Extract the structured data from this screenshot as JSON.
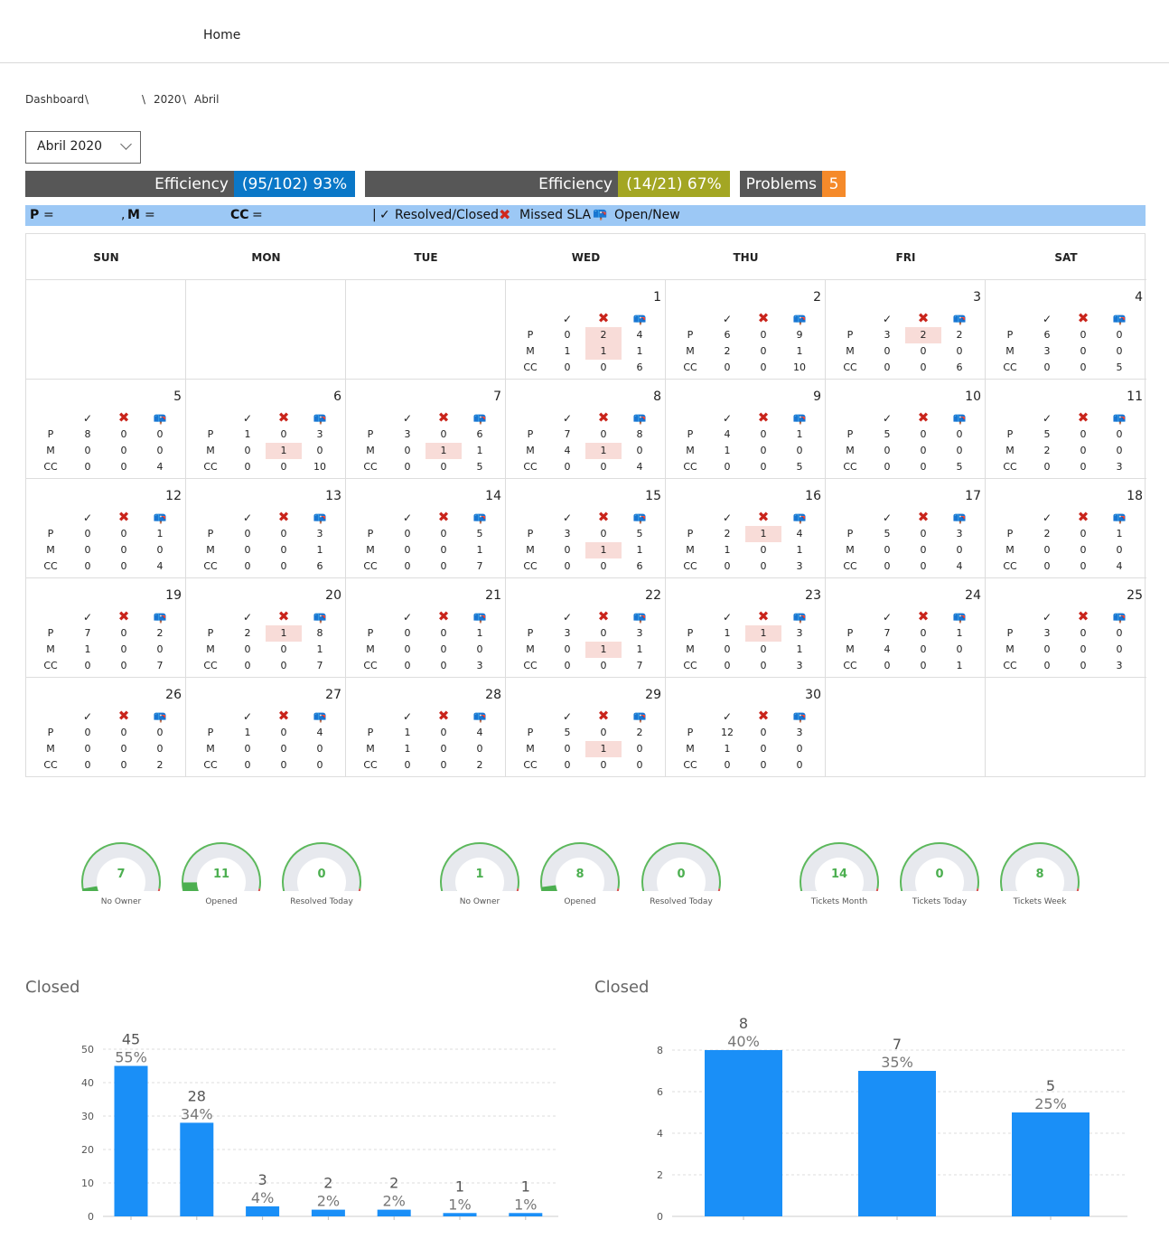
{
  "nav": {
    "home": "Home"
  },
  "breadcrumb": {
    "dashboard": "Dashboard",
    "sep": "\\",
    "year": "2020",
    "month": "Abril"
  },
  "month_select": {
    "value": "Abril 2020"
  },
  "efficiency1": {
    "label": "Efficiency",
    "value": "(95/102) 93%",
    "color": "#0a77c7"
  },
  "efficiency2": {
    "label": "Efficiency",
    "value": "(14/21) 67%",
    "color": "#a3a623"
  },
  "problems": {
    "label": "Problems",
    "value": "5",
    "color": "#f58a2a"
  },
  "legend": {
    "p": "P",
    "m": "M",
    "cc": "CC",
    "eq": "=",
    "sep": "|",
    "resolved": "Resolved/Closed",
    "missed": "Missed SLA",
    "open": "Open/New",
    "resolved_icon": "check-icon",
    "missed_icon": "x-mark-icon",
    "open_icon": "mailbox-icon"
  },
  "calendar": {
    "weekdays": [
      "SUN",
      "MON",
      "TUE",
      "WED",
      "THU",
      "FRI",
      "SAT"
    ],
    "row_labels": [
      "P",
      "M",
      "CC"
    ],
    "icons": {
      "check": "✓",
      "x": "✖",
      "open": "📪"
    },
    "first_weekday": 3,
    "days": [
      {
        "n": "1",
        "r": [
          [
            "0",
            "2",
            "4"
          ],
          [
            "1",
            "1",
            "1"
          ],
          [
            "0",
            "0",
            "6"
          ]
        ],
        "hl": [
          [
            0,
            1
          ],
          [
            1,
            1
          ]
        ]
      },
      {
        "n": "2",
        "r": [
          [
            "6",
            "0",
            "9"
          ],
          [
            "2",
            "0",
            "1"
          ],
          [
            "0",
            "0",
            "10"
          ]
        ],
        "hl": []
      },
      {
        "n": "3",
        "r": [
          [
            "3",
            "2",
            "2"
          ],
          [
            "0",
            "0",
            "0"
          ],
          [
            "0",
            "0",
            "6"
          ]
        ],
        "hl": [
          [
            0,
            1
          ]
        ]
      },
      {
        "n": "4",
        "r": [
          [
            "6",
            "0",
            "0"
          ],
          [
            "3",
            "0",
            "0"
          ],
          [
            "0",
            "0",
            "5"
          ]
        ],
        "hl": []
      },
      {
        "n": "5",
        "r": [
          [
            "8",
            "0",
            "0"
          ],
          [
            "0",
            "0",
            "0"
          ],
          [
            "0",
            "0",
            "4"
          ]
        ],
        "hl": []
      },
      {
        "n": "6",
        "r": [
          [
            "1",
            "0",
            "3"
          ],
          [
            "0",
            "1",
            "0"
          ],
          [
            "0",
            "0",
            "10"
          ]
        ],
        "hl": [
          [
            1,
            1
          ]
        ]
      },
      {
        "n": "7",
        "r": [
          [
            "3",
            "0",
            "6"
          ],
          [
            "0",
            "1",
            "1"
          ],
          [
            "0",
            "0",
            "5"
          ]
        ],
        "hl": [
          [
            1,
            1
          ]
        ]
      },
      {
        "n": "8",
        "r": [
          [
            "7",
            "0",
            "8"
          ],
          [
            "4",
            "1",
            "0"
          ],
          [
            "0",
            "0",
            "4"
          ]
        ],
        "hl": [
          [
            1,
            1
          ]
        ]
      },
      {
        "n": "9",
        "r": [
          [
            "4",
            "0",
            "1"
          ],
          [
            "1",
            "0",
            "0"
          ],
          [
            "0",
            "0",
            "5"
          ]
        ],
        "hl": []
      },
      {
        "n": "10",
        "r": [
          [
            "5",
            "0",
            "0"
          ],
          [
            "0",
            "0",
            "0"
          ],
          [
            "0",
            "0",
            "5"
          ]
        ],
        "hl": []
      },
      {
        "n": "11",
        "r": [
          [
            "5",
            "0",
            "0"
          ],
          [
            "2",
            "0",
            "0"
          ],
          [
            "0",
            "0",
            "3"
          ]
        ],
        "hl": []
      },
      {
        "n": "12",
        "r": [
          [
            "0",
            "0",
            "1"
          ],
          [
            "0",
            "0",
            "0"
          ],
          [
            "0",
            "0",
            "4"
          ]
        ],
        "hl": []
      },
      {
        "n": "13",
        "r": [
          [
            "0",
            "0",
            "3"
          ],
          [
            "0",
            "0",
            "1"
          ],
          [
            "0",
            "0",
            "6"
          ]
        ],
        "hl": []
      },
      {
        "n": "14",
        "r": [
          [
            "0",
            "0",
            "5"
          ],
          [
            "0",
            "0",
            "1"
          ],
          [
            "0",
            "0",
            "7"
          ]
        ],
        "hl": []
      },
      {
        "n": "15",
        "r": [
          [
            "3",
            "0",
            "5"
          ],
          [
            "0",
            "1",
            "1"
          ],
          [
            "0",
            "0",
            "6"
          ]
        ],
        "hl": [
          [
            1,
            1
          ]
        ]
      },
      {
        "n": "16",
        "r": [
          [
            "2",
            "1",
            "4"
          ],
          [
            "1",
            "0",
            "1"
          ],
          [
            "0",
            "0",
            "3"
          ]
        ],
        "hl": [
          [
            0,
            1
          ]
        ]
      },
      {
        "n": "17",
        "r": [
          [
            "5",
            "0",
            "3"
          ],
          [
            "0",
            "0",
            "0"
          ],
          [
            "0",
            "0",
            "4"
          ]
        ],
        "hl": []
      },
      {
        "n": "18",
        "r": [
          [
            "2",
            "0",
            "1"
          ],
          [
            "0",
            "0",
            "0"
          ],
          [
            "0",
            "0",
            "4"
          ]
        ],
        "hl": []
      },
      {
        "n": "19",
        "r": [
          [
            "7",
            "0",
            "2"
          ],
          [
            "1",
            "0",
            "0"
          ],
          [
            "0",
            "0",
            "7"
          ]
        ],
        "hl": []
      },
      {
        "n": "20",
        "r": [
          [
            "2",
            "1",
            "8"
          ],
          [
            "0",
            "0",
            "1"
          ],
          [
            "0",
            "0",
            "7"
          ]
        ],
        "hl": [
          [
            0,
            1
          ]
        ]
      },
      {
        "n": "21",
        "r": [
          [
            "0",
            "0",
            "1"
          ],
          [
            "0",
            "0",
            "0"
          ],
          [
            "0",
            "0",
            "3"
          ]
        ],
        "hl": []
      },
      {
        "n": "22",
        "r": [
          [
            "3",
            "0",
            "3"
          ],
          [
            "0",
            "1",
            "1"
          ],
          [
            "0",
            "0",
            "7"
          ]
        ],
        "hl": [
          [
            1,
            1
          ]
        ]
      },
      {
        "n": "23",
        "r": [
          [
            "1",
            "1",
            "3"
          ],
          [
            "0",
            "0",
            "1"
          ],
          [
            "0",
            "0",
            "3"
          ]
        ],
        "hl": [
          [
            0,
            1
          ]
        ]
      },
      {
        "n": "24",
        "r": [
          [
            "7",
            "0",
            "1"
          ],
          [
            "4",
            "0",
            "0"
          ],
          [
            "0",
            "0",
            "1"
          ]
        ],
        "hl": []
      },
      {
        "n": "25",
        "r": [
          [
            "3",
            "0",
            "0"
          ],
          [
            "0",
            "0",
            "0"
          ],
          [
            "0",
            "0",
            "3"
          ]
        ],
        "hl": []
      },
      {
        "n": "26",
        "r": [
          [
            "0",
            "0",
            "0"
          ],
          [
            "0",
            "0",
            "0"
          ],
          [
            "0",
            "0",
            "2"
          ]
        ],
        "hl": []
      },
      {
        "n": "27",
        "r": [
          [
            "1",
            "0",
            "4"
          ],
          [
            "0",
            "0",
            "0"
          ],
          [
            "0",
            "0",
            "0"
          ]
        ],
        "hl": []
      },
      {
        "n": "28",
        "r": [
          [
            "1",
            "0",
            "4"
          ],
          [
            "1",
            "0",
            "0"
          ],
          [
            "0",
            "0",
            "2"
          ]
        ],
        "hl": []
      },
      {
        "n": "29",
        "r": [
          [
            "5",
            "0",
            "2"
          ],
          [
            "0",
            "1",
            "0"
          ],
          [
            "0",
            "0",
            "0"
          ]
        ],
        "hl": [
          [
            1,
            1
          ]
        ]
      },
      {
        "n": "30",
        "r": [
          [
            "12",
            "0",
            "3"
          ],
          [
            "1",
            "0",
            "0"
          ],
          [
            "0",
            "0",
            "0"
          ]
        ],
        "hl": []
      }
    ]
  },
  "gauges": [
    {
      "label": "No Owner",
      "value": "7",
      "fill": 0.06
    },
    {
      "label": "Opened",
      "value": "11",
      "fill": 0.1
    },
    {
      "label": "Resolved Today",
      "value": "0",
      "fill": 0
    },
    {
      "label": "No Owner",
      "value": "1",
      "fill": 0.01
    },
    {
      "label": "Opened",
      "value": "8",
      "fill": 0.07
    },
    {
      "label": "Resolved Today",
      "value": "0",
      "fill": 0
    },
    {
      "label": "Tickets Month",
      "value": "14",
      "fill": 0.01
    },
    {
      "label": "Tickets Today",
      "value": "0",
      "fill": 0
    },
    {
      "label": "Tickets Week",
      "value": "8",
      "fill": 0.01
    }
  ],
  "chart_data": [
    {
      "type": "bar",
      "title": "Closed",
      "categories": [
        "",
        "",
        "",
        "",
        "",
        "",
        ""
      ],
      "values": [
        45,
        28,
        3,
        2,
        2,
        1,
        1
      ],
      "labels": [
        "55%",
        "34%",
        "4%",
        "2%",
        "2%",
        "1%",
        "1%"
      ],
      "ylim": [
        0,
        50
      ],
      "yticks": [
        0,
        10,
        20,
        30,
        40,
        50
      ],
      "color": "#1a8ff7",
      "grid": true
    },
    {
      "type": "bar",
      "title": "Closed",
      "categories": [
        "",
        "",
        ""
      ],
      "values": [
        8,
        7,
        5
      ],
      "labels": [
        "40%",
        "35%",
        "25%"
      ],
      "ylim": [
        0,
        8
      ],
      "yticks": [
        0,
        2,
        4,
        6,
        8
      ],
      "color": "#1a8ff7",
      "grid": true
    }
  ]
}
